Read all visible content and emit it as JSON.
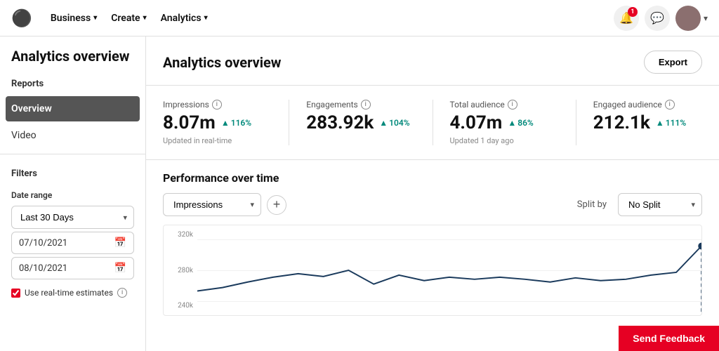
{
  "nav": {
    "logo": "P",
    "items": [
      {
        "label": "Business",
        "id": "business"
      },
      {
        "label": "Create",
        "id": "create"
      },
      {
        "label": "Analytics",
        "id": "analytics"
      }
    ],
    "notification_badge": "1"
  },
  "page": {
    "title": "Analytics overview",
    "export_label": "Export"
  },
  "sidebar": {
    "reports_label": "Reports",
    "overview_label": "Overview",
    "video_label": "Video",
    "filters_label": "Filters",
    "date_range_label": "Date range",
    "date_range_value": "Last 30 Days",
    "date_start": "07/10/2021",
    "date_end": "08/10/2021",
    "realtime_label": "Use real-time estimates"
  },
  "stats": [
    {
      "label": "Impressions",
      "value": "8.07m",
      "change": "116%",
      "updated": "Updated in real-time"
    },
    {
      "label": "Engagements",
      "value": "283.92k",
      "change": "104%",
      "updated": ""
    },
    {
      "label": "Total audience",
      "value": "4.07m",
      "change": "86%",
      "updated": "Updated 1 day ago"
    },
    {
      "label": "Engaged audience",
      "value": "212.1k",
      "change": "111%",
      "updated": ""
    }
  ],
  "performance": {
    "title": "Performance over time",
    "metric_label": "Impressions",
    "split_by_label": "Split by",
    "split_value": "No Split",
    "y_labels": [
      "320k",
      "280k",
      "240k"
    ],
    "chart_color": "#1a3a5c"
  },
  "feedback": {
    "label": "Send Feedback"
  }
}
